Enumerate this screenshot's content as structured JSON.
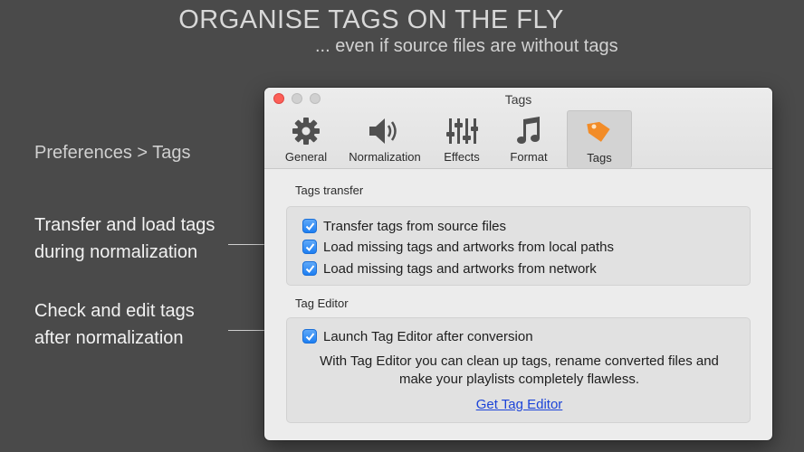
{
  "promo": {
    "headline": "ORGANISE TAGS ON THE FLY",
    "subline": "... even if source files are without tags",
    "breadcrumb": "Preferences > Tags",
    "note_transfer": [
      "Transfer and load tags",
      "during normalization"
    ],
    "note_edit": [
      "Check and edit tags",
      "after normalization"
    ]
  },
  "window": {
    "title": "Tags",
    "toolbar": [
      {
        "label": "General",
        "icon": "gear-icon"
      },
      {
        "label": "Normalization",
        "icon": "speaker-icon"
      },
      {
        "label": "Effects",
        "icon": "sliders-icon"
      },
      {
        "label": "Format",
        "icon": "music-note-icon"
      },
      {
        "label": "Tags",
        "icon": "tag-icon",
        "active": true
      }
    ],
    "tags_transfer": {
      "label": "Tags transfer",
      "options": [
        {
          "label": "Transfer tags from source files",
          "checked": true
        },
        {
          "label": "Load missing tags and artworks from local paths",
          "checked": true
        },
        {
          "label": "Load missing tags and artworks from network",
          "checked": true
        }
      ]
    },
    "tag_editor": {
      "label": "Tag Editor",
      "option": {
        "label": "Launch Tag Editor after conversion",
        "checked": true
      },
      "description": [
        "With Tag Editor you can clean up tags, rename converted files and",
        "make your playlists completely flawless."
      ],
      "link": "Get Tag Editor"
    }
  },
  "colors": {
    "background": "#4a4a4a",
    "checkbox": "#1d7ef2",
    "link": "#1c44d8",
    "tag_icon": "#f28c28"
  }
}
